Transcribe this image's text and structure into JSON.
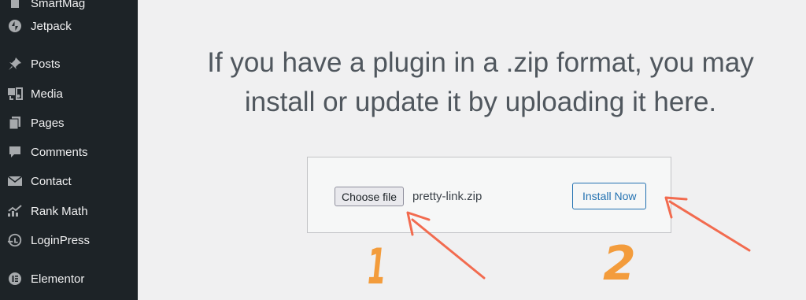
{
  "sidebar": {
    "items": [
      {
        "label": "SmartMag",
        "icon": "smartmag-icon"
      },
      {
        "label": "Jetpack",
        "icon": "jetpack-icon"
      },
      {
        "label": "Posts",
        "icon": "pin-icon"
      },
      {
        "label": "Media",
        "icon": "media-icon"
      },
      {
        "label": "Pages",
        "icon": "pages-icon"
      },
      {
        "label": "Comments",
        "icon": "comment-icon"
      },
      {
        "label": "Contact",
        "icon": "envelope-icon"
      },
      {
        "label": "Rank Math",
        "icon": "rank-math-icon"
      },
      {
        "label": "LoginPress",
        "icon": "loginpress-icon"
      },
      {
        "label": "Elementor",
        "icon": "elementor-icon"
      }
    ]
  },
  "main": {
    "help_line1": "If you have a plugin in a .zip format, you may",
    "help_line2": "install or update it by uploading it here.",
    "choose_file_label": "Choose file",
    "file_name": "pretty-link.zip",
    "install_label": "Install Now"
  },
  "annotations": {
    "step1": "1",
    "step2": "2",
    "arrow_color": "#f26b4f",
    "number_color": "#f39c3c"
  }
}
